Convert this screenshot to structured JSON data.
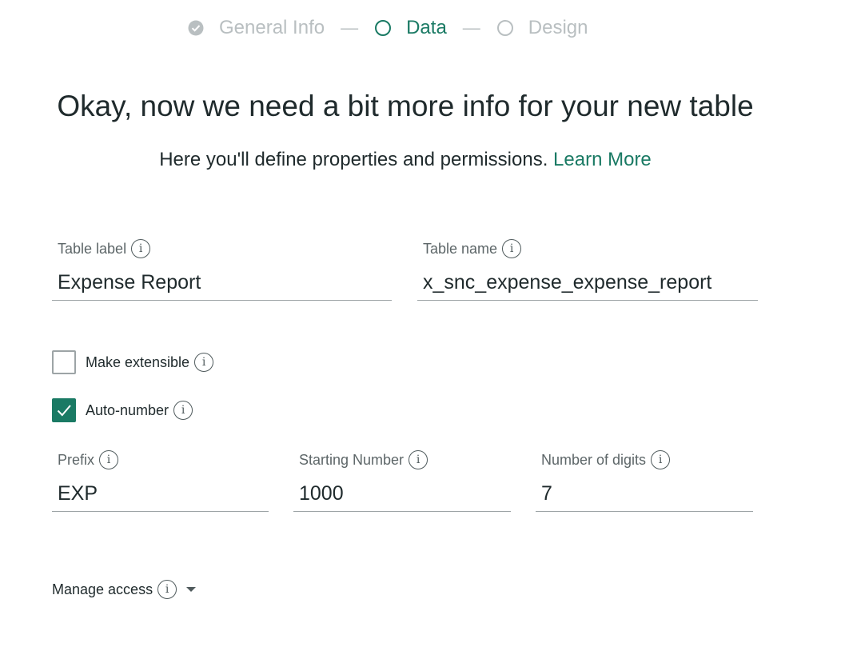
{
  "stepper": {
    "steps": [
      {
        "label": "General Info",
        "state": "done",
        "icon": "check-circle-icon"
      },
      {
        "label": "Data",
        "state": "active",
        "icon": "circle-outline-icon"
      },
      {
        "label": "Design",
        "state": "todo",
        "icon": "circle-outline-icon"
      }
    ],
    "separator": "—"
  },
  "header": {
    "title": "Okay, now we need a bit more info for your new table",
    "subtitle": "Here you'll define properties and permissions.",
    "learn_more": "Learn More"
  },
  "form": {
    "table_label": {
      "label": "Table label",
      "value": "Expense Report"
    },
    "table_name": {
      "label": "Table name",
      "value": "x_snc_expense_expense_report"
    },
    "make_extensible": {
      "label": "Make extensible",
      "checked": false
    },
    "auto_number": {
      "label": "Auto-number",
      "checked": true
    },
    "prefix": {
      "label": "Prefix",
      "value": "EXP"
    },
    "starting_number": {
      "label": "Starting Number",
      "value": "1000"
    },
    "number_of_digits": {
      "label": "Number of digits",
      "value": "7"
    },
    "manage_access": {
      "label": "Manage access"
    }
  },
  "colors": {
    "accent": "#1a7a64",
    "muted": "#b9bfc1",
    "text": "#1f2a2c"
  }
}
